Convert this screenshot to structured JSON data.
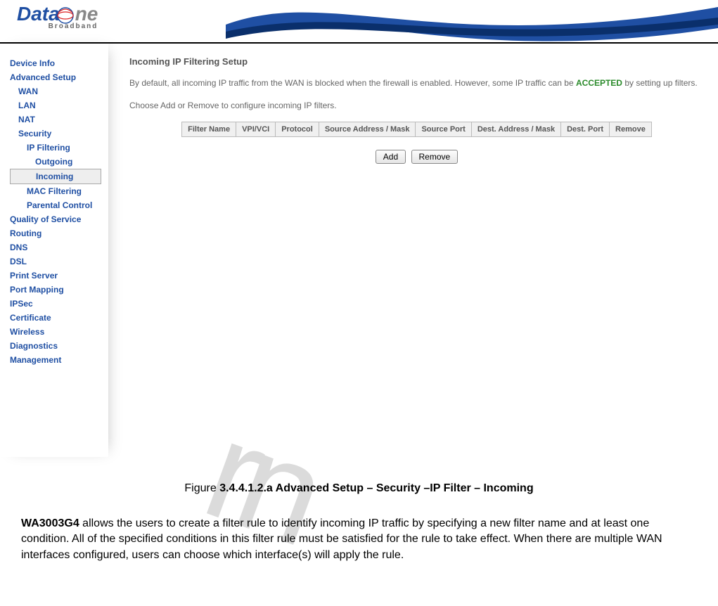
{
  "logo": {
    "word1": "Data",
    "word2": "ne",
    "sub": "Broadband"
  },
  "sidebar": {
    "items": [
      {
        "label": "Device Info",
        "cls": ""
      },
      {
        "label": "Advanced Setup",
        "cls": ""
      },
      {
        "label": "WAN",
        "cls": "sub"
      },
      {
        "label": "LAN",
        "cls": "sub"
      },
      {
        "label": "NAT",
        "cls": "sub"
      },
      {
        "label": "Security",
        "cls": "sub"
      },
      {
        "label": "IP Filtering",
        "cls": "subsub"
      },
      {
        "label": "Outgoing",
        "cls": "subsubsub"
      },
      {
        "label": "Incoming",
        "cls": "subsubsub active"
      },
      {
        "label": "MAC Filtering",
        "cls": "subsub"
      },
      {
        "label": "Parental Control",
        "cls": "subsub"
      },
      {
        "label": "Quality of Service",
        "cls": ""
      },
      {
        "label": "Routing",
        "cls": ""
      },
      {
        "label": "DNS",
        "cls": ""
      },
      {
        "label": "DSL",
        "cls": ""
      },
      {
        "label": "Print Server",
        "cls": ""
      },
      {
        "label": "Port Mapping",
        "cls": ""
      },
      {
        "label": "IPSec",
        "cls": ""
      },
      {
        "label": "Certificate",
        "cls": ""
      },
      {
        "label": "Wireless",
        "cls": ""
      },
      {
        "label": "Diagnostics",
        "cls": ""
      },
      {
        "label": "Management",
        "cls": ""
      }
    ]
  },
  "page": {
    "title": "Incoming IP Filtering Setup",
    "desc_pre": "By default, all incoming IP traffic from the WAN is blocked when the firewall is enabled. However, some IP traffic can be ",
    "desc_accepted": "ACCEPTED",
    "desc_post": " by setting up filters.",
    "desc2": "Choose Add or Remove to configure incoming IP filters.",
    "table_headers": [
      "Filter Name",
      "VPI/VCI",
      "Protocol",
      "Source Address / Mask",
      "Source Port",
      "Dest. Address / Mask",
      "Dest. Port",
      "Remove"
    ],
    "buttons": {
      "add": "Add",
      "remove": "Remove"
    }
  },
  "caption": {
    "prefix": "Figure ",
    "bold": "3.4.4.1.2.a Advanced Setup – Security –IP Filter – Incoming"
  },
  "bodytext": {
    "model": "WA3003G4",
    "rest": " allows the users to create a filter rule to identify incoming IP traffic by specifying a new filter name and at least one condition. All of the specified conditions in this filter rule must be satisfied for the rule to take effect. When there are multiple WAN interfaces configured, users can choose which interface(s) will apply the rule."
  }
}
